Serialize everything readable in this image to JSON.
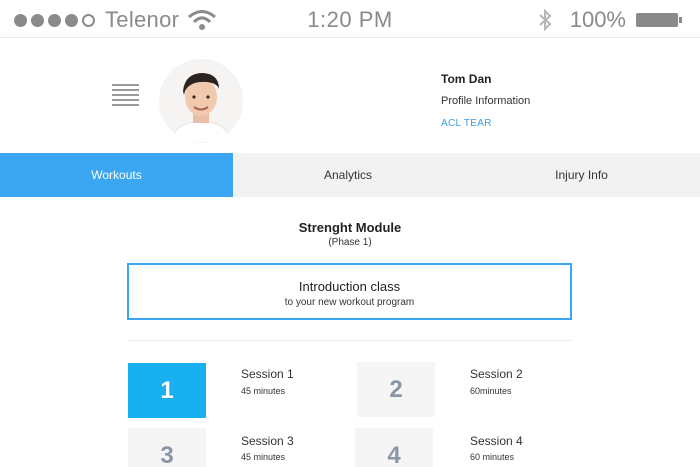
{
  "status_bar": {
    "carrier": "Telenor",
    "time": "1:20 PM",
    "battery": "100%",
    "signal_icon": "signal-dots-icon",
    "wifi_icon": "wifi-icon",
    "bluetooth_icon": "bluetooth-icon",
    "battery_icon": "battery-icon"
  },
  "profile": {
    "menu_icon": "hamburger-menu-icon",
    "name": "Tom Dan",
    "subtitle": "Profile Information",
    "condition": "ACL TEAR"
  },
  "tabs": [
    {
      "label": "Workouts",
      "active": true
    },
    {
      "label": "Analytics",
      "active": false
    },
    {
      "label": "Injury Info",
      "active": false
    }
  ],
  "module": {
    "title": "Strenght Module",
    "phase": "(Phase 1)"
  },
  "intro": {
    "title": "Introduction class",
    "subtitle": "to your new workout program"
  },
  "sessions": [
    {
      "number": "1",
      "title": "Session 1",
      "duration": "45 minutes",
      "active": true
    },
    {
      "number": "2",
      "title": "Session 2",
      "duration": "60minutes",
      "active": false
    },
    {
      "number": "3",
      "title": "Session 3",
      "duration": "45 minutes",
      "active": false
    },
    {
      "number": "4",
      "title": "Session 4",
      "duration": "60 minutes",
      "active": false
    }
  ],
  "colors": {
    "accent": "#3ba6f2",
    "active_tile": "#19b0f2",
    "link": "#3ba0e6",
    "tab_bar": "#f2f2f2"
  }
}
